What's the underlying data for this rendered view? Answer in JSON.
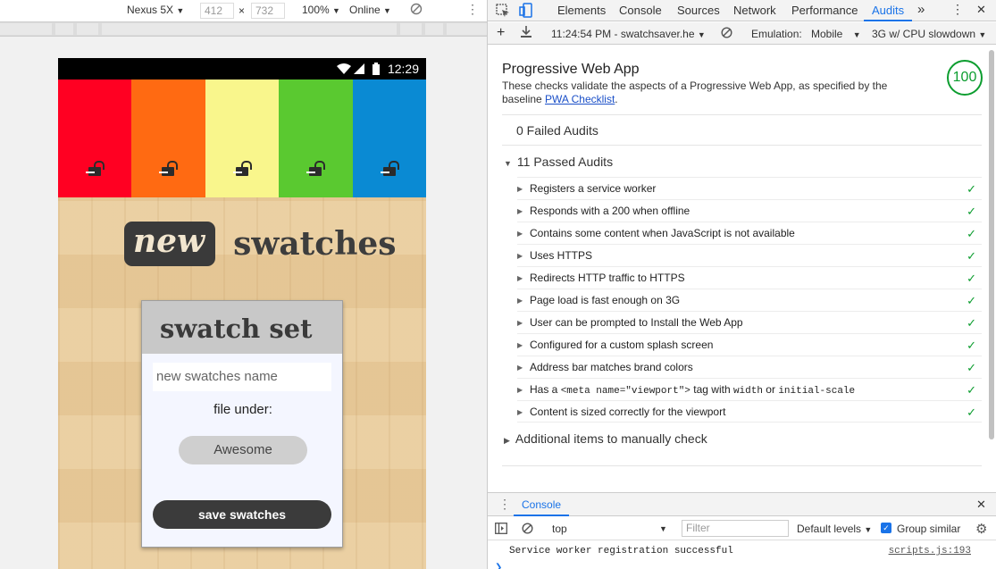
{
  "device_toolbar": {
    "device": "Nexus 5X",
    "width": "412",
    "times": "×",
    "height": "732",
    "zoom": "100%",
    "network": "Online"
  },
  "phone": {
    "status_time": "12:29",
    "swatch_colors": [
      "#ff0022",
      "#ff6a12",
      "#f9f68c",
      "#5ac930",
      "#0a8ad3"
    ],
    "title_new": "new",
    "title_swatches": "swatches",
    "card": {
      "title": "swatch set",
      "name_placeholder": "new swatches name",
      "file_under_label": "file under:",
      "category": "Awesome",
      "save_label": "save swatches"
    }
  },
  "devtools": {
    "tabs": [
      "Elements",
      "Console",
      "Sources",
      "Network",
      "Performance",
      "Audits"
    ],
    "more_tabs": "»",
    "subtoolbar": {
      "report": "11:24:54 PM - swatchsaver.he",
      "emulation_label": "Emulation:",
      "emulation_device": "Mobile",
      "throttling": "3G w/ CPU slowdown"
    },
    "report": {
      "title": "Progressive Web App",
      "description": "These checks validate the aspects of a Progressive Web App, as specified by the baseline",
      "link_text": "PWA Checklist",
      "period": ".",
      "score": "100",
      "failed": "0 Failed Audits",
      "passed": "11 Passed Audits",
      "manual": "Additional items to manually check",
      "audits": [
        "Registers a service worker",
        "Responds with a 200 when offline",
        "Contains some content when JavaScript is not available",
        "Uses HTTPS",
        "Redirects HTTP traffic to HTTPS",
        "Page load is fast enough on 3G",
        "User can be prompted to Install the Web App",
        "Configured for a custom splash screen",
        "Address bar matches brand colors"
      ],
      "viewport_audit": {
        "pre": "Has a ",
        "code1": "<meta name=\"viewport\">",
        "mid": " tag with ",
        "code2": "width",
        "or": " or ",
        "code3": "initial-scale"
      },
      "last_audit": "Content is sized correctly for the viewport"
    },
    "console": {
      "tab": "Console",
      "context": "top",
      "filter_placeholder": "Filter",
      "levels": "Default levels",
      "group_similar": "Group similar",
      "message": "Service worker registration successful",
      "source": "scripts.js:193"
    }
  }
}
